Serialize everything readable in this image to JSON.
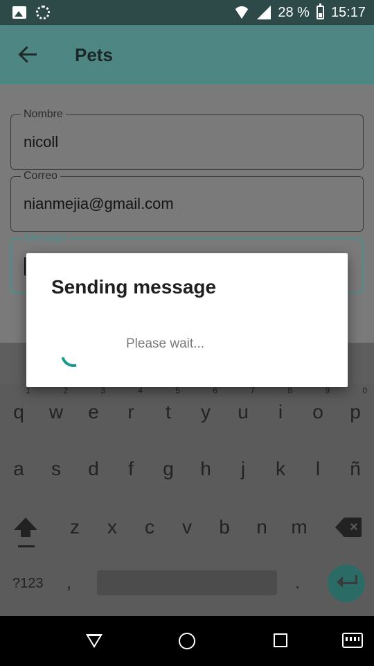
{
  "status_bar": {
    "battery_percent": "28 %",
    "time": "15:17",
    "icons": [
      "photo-icon",
      "sync-icon",
      "wifi-icon",
      "signal-icon",
      "battery-charging-icon"
    ]
  },
  "app_bar": {
    "title": "Pets",
    "back_icon": "arrow-back-icon"
  },
  "form": {
    "name": {
      "label": "Nombre",
      "value": "nicoll"
    },
    "email": {
      "label": "Correo",
      "value": "nianmejia@gmail.com"
    },
    "message": {
      "label": "Mensaje",
      "value": ""
    }
  },
  "dialog": {
    "title": "Sending message",
    "message": "Please wait..."
  },
  "keyboard": {
    "row1": [
      {
        "key": "q",
        "num": "1"
      },
      {
        "key": "w",
        "num": "2"
      },
      {
        "key": "e",
        "num": "3"
      },
      {
        "key": "r",
        "num": "4"
      },
      {
        "key": "t",
        "num": "5"
      },
      {
        "key": "y",
        "num": "6"
      },
      {
        "key": "u",
        "num": "7"
      },
      {
        "key": "i",
        "num": "8"
      },
      {
        "key": "o",
        "num": "9"
      },
      {
        "key": "p",
        "num": "0"
      }
    ],
    "row2": [
      "a",
      "s",
      "d",
      "f",
      "g",
      "h",
      "j",
      "k",
      "l",
      "ñ"
    ],
    "row3": [
      "z",
      "x",
      "c",
      "v",
      "b",
      "n",
      "m"
    ],
    "symbols_label": "?123",
    "comma": ",",
    "period": "."
  },
  "colors": {
    "accent": "#199a8e",
    "app_bar": "#4e8684",
    "status_bar": "#2e4a48"
  }
}
